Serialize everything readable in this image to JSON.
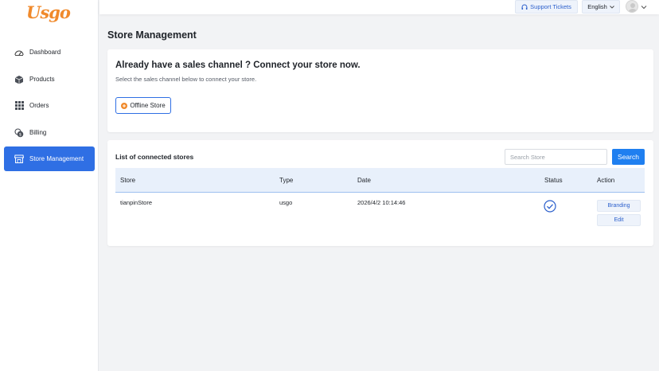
{
  "brand": {
    "logo_text": "Usgo",
    "accent": "#f08a2c",
    "primary": "#2f6fe4"
  },
  "sidebar": {
    "items": [
      {
        "label": "Dashboard",
        "icon": "gauge-icon"
      },
      {
        "label": "Products",
        "icon": "box-icon"
      },
      {
        "label": "Orders",
        "icon": "grid-icon"
      },
      {
        "label": "Billing",
        "icon": "coins-icon"
      },
      {
        "label": "Store Management",
        "icon": "storefront-icon",
        "active": true
      }
    ]
  },
  "topbar": {
    "support_label": "Support Tickets",
    "language_label": "English"
  },
  "page": {
    "title": "Store Management"
  },
  "connect": {
    "heading": "Already have a sales channel ? Connect your store now.",
    "subtext": "Select the sales channel below to connect your store.",
    "offline_store_label": "Offline Store"
  },
  "stores": {
    "title": "List of connected stores",
    "search_placeholder": "Search Store",
    "search_button": "Search",
    "columns": [
      "Store",
      "Type",
      "Date",
      "Status",
      "Action"
    ],
    "rows": [
      {
        "store": "tianpinStore",
        "type": "usgo",
        "date": "2026/4/2 10:14:46",
        "status": "connected",
        "actions": [
          "Branding",
          "Edit"
        ]
      }
    ]
  }
}
